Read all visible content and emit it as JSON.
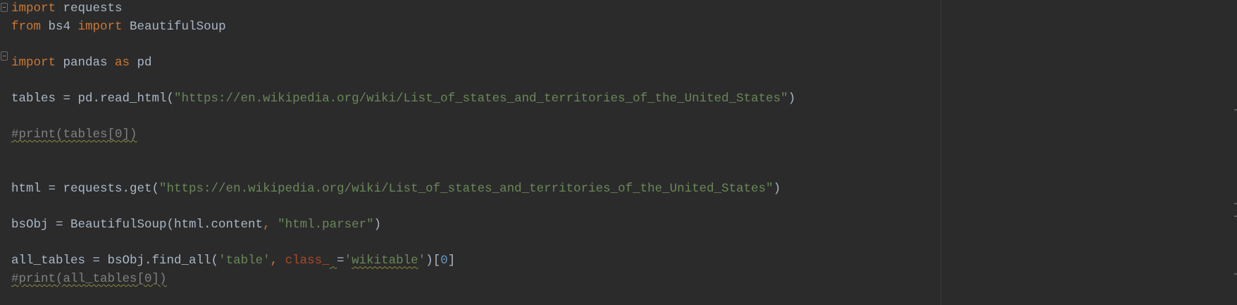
{
  "editor": {
    "lines": [
      [
        {
          "t": "import",
          "c": "kw"
        },
        {
          "t": " requests",
          "c": ""
        }
      ],
      [
        {
          "t": "from",
          "c": "kw"
        },
        {
          "t": " bs4 ",
          "c": ""
        },
        {
          "t": "import",
          "c": "kw"
        },
        {
          "t": " BeautifulSoup",
          "c": ""
        }
      ],
      [],
      [
        {
          "t": "import",
          "c": "kw"
        },
        {
          "t": " pandas ",
          "c": ""
        },
        {
          "t": "as",
          "c": "kw"
        },
        {
          "t": " pd",
          "c": ""
        }
      ],
      [],
      [
        {
          "t": "tables = pd.read_html(",
          "c": ""
        },
        {
          "t": "\"https://en.wikipedia.org/wiki/List_of_states_and_territories_of_the_United_States\"",
          "c": "str"
        },
        {
          "t": ")",
          "c": ""
        }
      ],
      [],
      [
        {
          "t": "#print(tables[0])",
          "c": "cmt"
        }
      ],
      [],
      [],
      [
        {
          "t": "html = requests.get(",
          "c": ""
        },
        {
          "t": "\"https://en.wikipedia.org/wiki/List_of_states_and_territories_of_the_United_States\"",
          "c": "str"
        },
        {
          "t": ")",
          "c": ""
        }
      ],
      [],
      [
        {
          "t": "bsObj = BeautifulSoup(html.content",
          "c": ""
        },
        {
          "t": ", ",
          "c": "kw"
        },
        {
          "t": "\"html.parser\"",
          "c": "str"
        },
        {
          "t": ")",
          "c": ""
        }
      ],
      [],
      [
        {
          "t": "all_tables = bsObj.find_all(",
          "c": ""
        },
        {
          "t": "'table'",
          "c": "str"
        },
        {
          "t": ", ",
          "c": "kw"
        },
        {
          "t": "class_",
          "c": "kwarg"
        },
        {
          "t": " ",
          "c": "wavy"
        },
        {
          "t": "=",
          "c": ""
        },
        {
          "t": "'",
          "c": "str"
        },
        {
          "t": "wikitable",
          "c": "str wavy"
        },
        {
          "t": "'",
          "c": "str"
        },
        {
          "t": ")[",
          "c": ""
        },
        {
          "t": "0",
          "c": "num"
        },
        {
          "t": "]",
          "c": ""
        }
      ],
      [
        {
          "t": "#print(all_tables[0])",
          "c": "cmt"
        }
      ]
    ]
  }
}
